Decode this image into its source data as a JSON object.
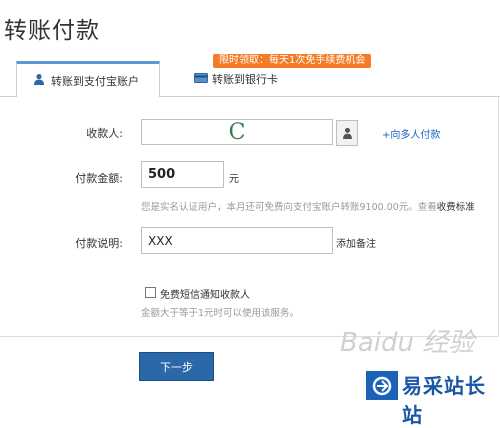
{
  "page": {
    "title": "转账付款"
  },
  "promo": {
    "text": "限时领取：每天1次免手续费机会"
  },
  "tabs": [
    {
      "label": "转账到支付宝账户",
      "active": true,
      "icon": "user-icon"
    },
    {
      "label": "转账到银行卡",
      "active": false,
      "icon": "bank-card-icon"
    }
  ],
  "form": {
    "payee": {
      "label": "收款人:",
      "value": "C",
      "link": "+向多人付款",
      "icon": "contacts-icon"
    },
    "amount": {
      "label": "付款金额:",
      "value": "500",
      "unit": "元",
      "hint": "您是实名认证用户，本月还可免费向支付宝账户转账9100.00元。查看",
      "hint_link": "收费标准"
    },
    "note": {
      "label": "付款说明:",
      "value": "XXX",
      "action": "添加备注"
    },
    "sms": {
      "label": "免费短信通知收款人",
      "checked": false,
      "hint": "金额大于等于1元时可以使用该服务。"
    }
  },
  "submit": {
    "label": "下一步"
  },
  "watermark": {
    "text": "Baidu 经验"
  },
  "brand": {
    "text": "易采站长站",
    "color": "#1a56a8"
  },
  "colors": {
    "accent": "#2a68a8",
    "promo": "#f57c26",
    "link": "#1565c0"
  }
}
